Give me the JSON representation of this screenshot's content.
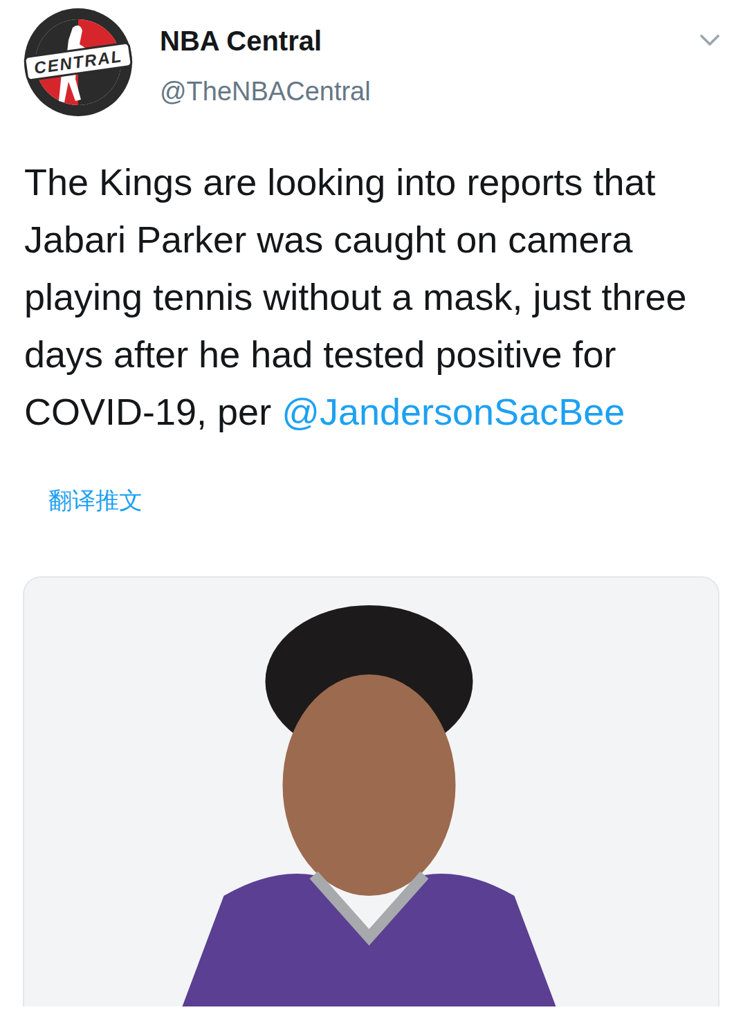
{
  "account": {
    "name": "NBA Central",
    "handle": "@TheNBACentral",
    "logo_text": "CENTRAL"
  },
  "tweet": {
    "text": "The Kings are looking into reports that Jabari Parker was caught on camera playing tennis without a mask, just three days after he had tested positive for COVID-19, per ",
    "mention": "@JandersonSacBee"
  },
  "translate": "翻译推文"
}
